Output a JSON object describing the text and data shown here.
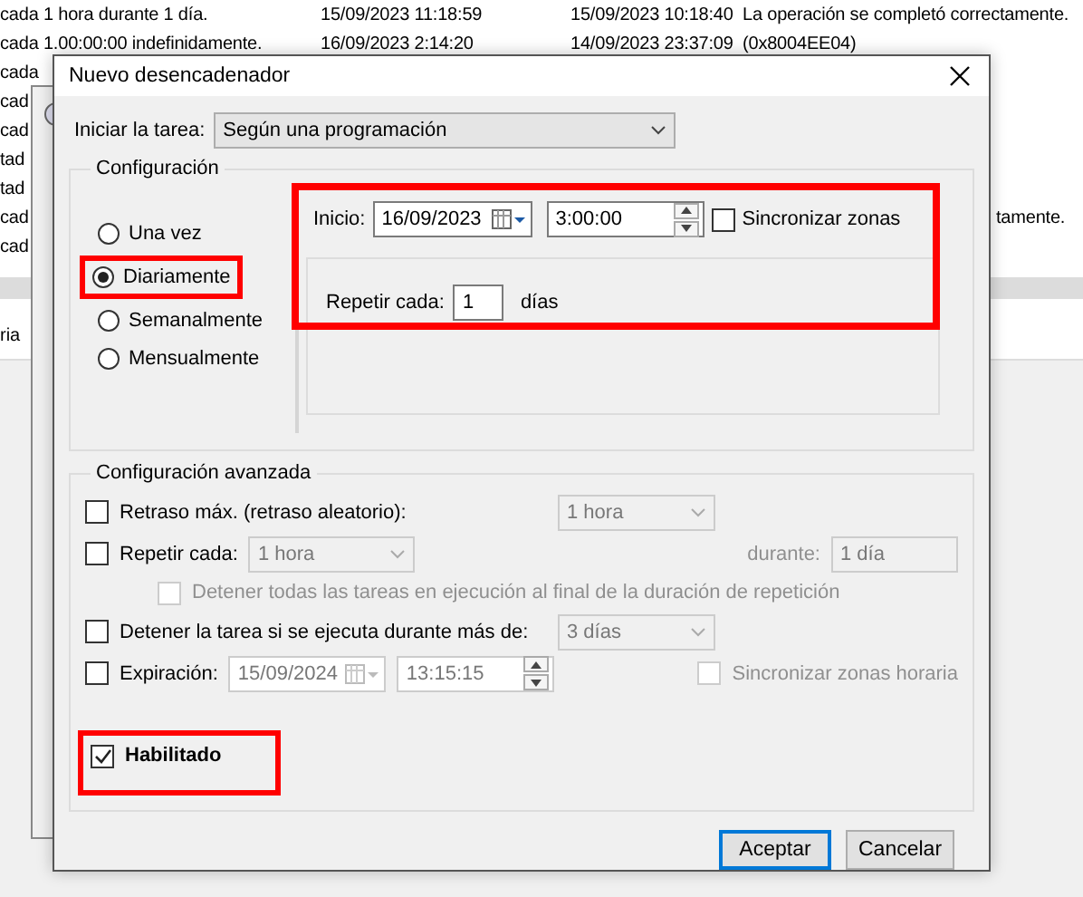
{
  "background_table": {
    "rows": [
      {
        "column_1": "cada 1 hora durante 1 día.",
        "column_2": "15/09/2023 11:18:59",
        "column_3": "15/09/2023 10:18:40",
        "column_4": "La operación se completó correctamente."
      },
      {
        "column_1": "cada 1.00:00:00 indefinidamente.",
        "column_2": "16/09/2023 2:14:20",
        "column_3": "14/09/2023 23:37:09",
        "column_4": "(0x8004EE04)"
      },
      {
        "column_1": "cada"
      },
      {
        "column_1": "cad"
      },
      {
        "column_1": "cad"
      },
      {
        "column_1": "tad"
      },
      {
        "column_1": "tad"
      },
      {
        "column_1": "cad",
        "column_4": "tamente."
      },
      {
        "column_1": "cad"
      }
    ],
    "lower_fragment": "ria"
  },
  "dialog": {
    "title": "Nuevo desencadenador",
    "start": {
      "label": "Iniciar la tarea:",
      "value": "Según una programación"
    },
    "settings": {
      "title": "Configuración",
      "highlighted": true,
      "schedules": [
        {
          "label": "Una vez",
          "selected": false,
          "highlighted": false
        },
        {
          "label": "Diariamente",
          "selected": true,
          "highlighted": true
        },
        {
          "label": "Semanalmente",
          "selected": false,
          "highlighted": false
        },
        {
          "label": "Mensualmente",
          "selected": false,
          "highlighted": false
        }
      ],
      "start_label": "Inicio:",
      "date": "16/09/2023",
      "time": "3:00:00",
      "sync": {
        "label": "Sincronizar zonas",
        "checked": false
      },
      "repeat_label": "Repetir cada:",
      "repeat_value": "1",
      "repeat_unit": "días"
    },
    "advanced": {
      "title": "Configuración avanzada",
      "rows": [
        {
          "kind": "combo",
          "label": "Retraso máx. (retraso aleatorio):",
          "checked": false,
          "value": "1 hora"
        },
        {
          "kind": "repeat",
          "label": "Repetir cada:",
          "checked": false,
          "value": "1 hora",
          "during_label": "durante:",
          "during_value": "1 día"
        },
        {
          "kind": "sub",
          "label": "Detener todas las tareas en ejecución al final de la duración de repetición",
          "checked": false
        },
        {
          "kind": "combo",
          "label": "Detener la tarea si se ejecuta durante más de:",
          "checked": false,
          "value": "3 días"
        },
        {
          "kind": "expiry",
          "label": "Expiración:",
          "checked": false,
          "date": "15/09/2024",
          "time": "13:15:15",
          "sync_label": "Sincronizar zonas horaria",
          "sync_checked": false
        }
      ],
      "enabled": {
        "label": "Habilitado",
        "checked": true,
        "highlighted": true
      }
    },
    "buttons": [
      {
        "label": "Aceptar",
        "default": true
      },
      {
        "label": "Cancelar",
        "default": false
      }
    ]
  }
}
